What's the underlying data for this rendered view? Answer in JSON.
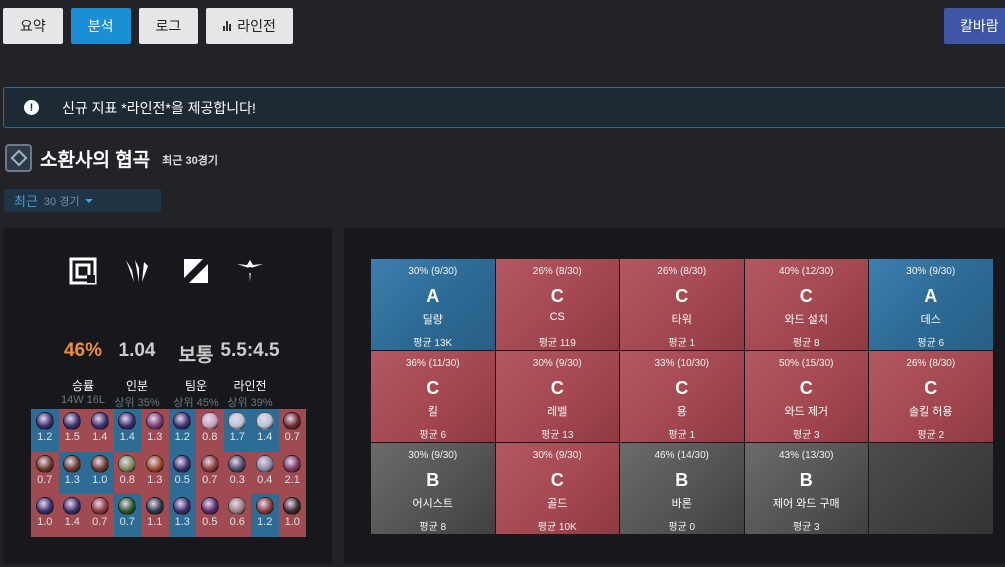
{
  "tabs": [
    {
      "label": "요약",
      "active": false
    },
    {
      "label": "분석",
      "active": true
    },
    {
      "label": "로그",
      "active": false
    },
    {
      "label": "라인전",
      "active": false,
      "icon": "bar-chart-icon"
    }
  ],
  "aram_label": "칼바람",
  "notice": {
    "text": "신규 지표 *라인전*을 제공합니다!",
    "icon": "info-icon"
  },
  "section": {
    "title": "소환사의 협곡",
    "subtitle": "최근 30경기"
  },
  "filter": {
    "label": "최근",
    "count": "30 경기"
  },
  "stats": [
    {
      "icon": "target-square-icon",
      "value": "46%",
      "label": "승률",
      "sub": "14W 16L",
      "highlight": true
    },
    {
      "icon": "claw-icon",
      "value": "1.04",
      "label": "인분",
      "sub": "상위 35%",
      "highlight": false
    },
    {
      "icon": "slash-square-icon",
      "value": "보통",
      "label": "팀운",
      "sub": "상위 45%",
      "highlight": false
    },
    {
      "icon": "bird-icon",
      "value": "5.5:4.5",
      "label": "라인전",
      "sub": "상위 39%",
      "highlight": false
    }
  ],
  "colors": {
    "win": "#2c6c95",
    "loss": "#a04a52",
    "accent": "#1a8fd6",
    "orange": "#f0903a"
  },
  "champions": [
    {
      "kda": "1.2",
      "result": "win",
      "color": "#3a2f6b"
    },
    {
      "kda": "1.5",
      "result": "loss",
      "color": "#3a2f6b"
    },
    {
      "kda": "1.4",
      "result": "loss",
      "color": "#3a2f6b"
    },
    {
      "kda": "1.4",
      "result": "win",
      "color": "#3a2f6b"
    },
    {
      "kda": "1.3",
      "result": "loss",
      "color": "#7a3a70"
    },
    {
      "kda": "1.2",
      "result": "win",
      "color": "#3a2f6b"
    },
    {
      "kda": "0.8",
      "result": "loss",
      "color": "#c9a0b8"
    },
    {
      "kda": "1.7",
      "result": "win",
      "color": "#b7c3d6"
    },
    {
      "kda": "1.4",
      "result": "win",
      "color": "#b7c3d6"
    },
    {
      "kda": "0.7",
      "result": "loss",
      "color": "#6a2a2a"
    },
    {
      "kda": "0.7",
      "result": "loss",
      "color": "#6a3a2a"
    },
    {
      "kda": "1.3",
      "result": "win",
      "color": "#6a3a2a"
    },
    {
      "kda": "1.0",
      "result": "win",
      "color": "#6a3a2a"
    },
    {
      "kda": "0.8",
      "result": "loss",
      "color": "#7c8a55"
    },
    {
      "kda": "1.3",
      "result": "loss",
      "color": "#9a4a2a"
    },
    {
      "kda": "0.5",
      "result": "win",
      "color": "#3a2f6b"
    },
    {
      "kda": "0.7",
      "result": "loss",
      "color": "#8a3a3a"
    },
    {
      "kda": "0.3",
      "result": "loss",
      "color": "#4a4a6a"
    },
    {
      "kda": "0.4",
      "result": "loss",
      "color": "#8a8aa0"
    },
    {
      "kda": "2.1",
      "result": "loss",
      "color": "#7a3a60"
    },
    {
      "kda": "1.0",
      "result": "loss",
      "color": "#3a2f6b"
    },
    {
      "kda": "1.4",
      "result": "loss",
      "color": "#3a2f6b"
    },
    {
      "kda": "0.7",
      "result": "loss",
      "color": "#8a3a3a"
    },
    {
      "kda": "0.7",
      "result": "win",
      "color": "#2a5a2a"
    },
    {
      "kda": "1.1",
      "result": "loss",
      "color": "#2a3a4a"
    },
    {
      "kda": "1.3",
      "result": "win",
      "color": "#3a2f6b"
    },
    {
      "kda": "0.5",
      "result": "loss",
      "color": "#5a2a6a"
    },
    {
      "kda": "0.6",
      "result": "loss",
      "color": "#a08080"
    },
    {
      "kda": "1.2",
      "result": "win",
      "color": "#8a3a3a"
    },
    {
      "kda": "1.0",
      "result": "loss",
      "color": "#3a2a2a"
    }
  ],
  "grades": [
    {
      "pct": "30% (9/30)",
      "grade": "A",
      "name": "딜량",
      "avg": "평균 13K",
      "tier": "a"
    },
    {
      "pct": "26% (8/30)",
      "grade": "C",
      "name": "CS",
      "avg": "평균 119",
      "tier": "c"
    },
    {
      "pct": "26% (8/30)",
      "grade": "C",
      "name": "타워",
      "avg": "평균 1",
      "tier": "c"
    },
    {
      "pct": "40% (12/30)",
      "grade": "C",
      "name": "와드 설치",
      "avg": "평균 8",
      "tier": "c"
    },
    {
      "pct": "30% (9/30)",
      "grade": "A",
      "name": "데스",
      "avg": "평균 6",
      "tier": "a"
    },
    {
      "pct": "36% (11/30)",
      "grade": "C",
      "name": "킬",
      "avg": "평균 6",
      "tier": "c"
    },
    {
      "pct": "30% (9/30)",
      "grade": "C",
      "name": "레벨",
      "avg": "평균 13",
      "tier": "c"
    },
    {
      "pct": "33% (10/30)",
      "grade": "C",
      "name": "용",
      "avg": "평균 1",
      "tier": "c"
    },
    {
      "pct": "50% (15/30)",
      "grade": "C",
      "name": "와드 제거",
      "avg": "평균 3",
      "tier": "c"
    },
    {
      "pct": "26% (8/30)",
      "grade": "C",
      "name": "솔킬 허용",
      "avg": "평균 2",
      "tier": "c"
    },
    {
      "pct": "30% (9/30)",
      "grade": "B",
      "name": "어시스트",
      "avg": "평균 8",
      "tier": "b"
    },
    {
      "pct": "30% (9/30)",
      "grade": "C",
      "name": "골드",
      "avg": "평균 10K",
      "tier": "c"
    },
    {
      "pct": "46% (14/30)",
      "grade": "B",
      "name": "바론",
      "avg": "평균 0",
      "tier": "b"
    },
    {
      "pct": "43% (13/30)",
      "grade": "B",
      "name": "제어 와드 구매",
      "avg": "평균 3",
      "tier": "b"
    },
    {
      "pct": "",
      "grade": "",
      "name": "",
      "avg": "",
      "tier": "empty"
    }
  ]
}
